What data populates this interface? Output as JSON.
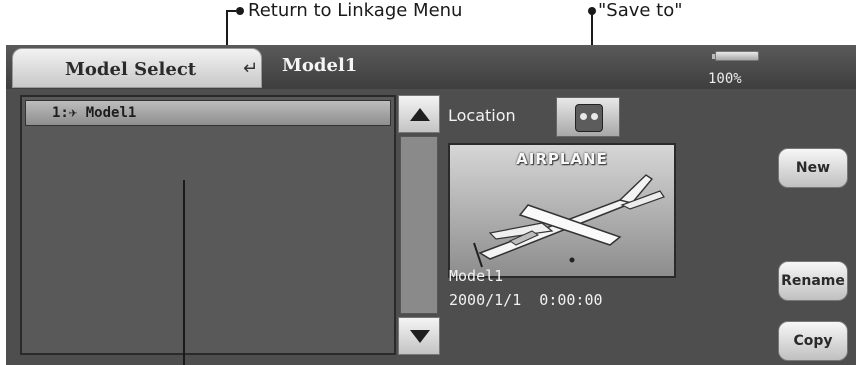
{
  "annotations": {
    "return_label": "Return to Linkage Menu",
    "save_to_label": "\"Save to\""
  },
  "header": {
    "tab_title": "Model Select",
    "return_icon": "return-door-icon",
    "model_name": "Model1",
    "battery_percent": "100%",
    "battery_level": 1.0
  },
  "model_list": {
    "items": [
      {
        "index_prefix": "1:",
        "icon": "airplane-icon",
        "name": "Model1"
      }
    ]
  },
  "info": {
    "location_label": "Location",
    "location_icon": "transmitter-icon",
    "model_type": "AIRPLANE",
    "model_name": "Model1",
    "date": "2000/1/1  0:00:00"
  },
  "buttons": {
    "new": "New",
    "rename": "Rename",
    "copy": "Copy"
  }
}
